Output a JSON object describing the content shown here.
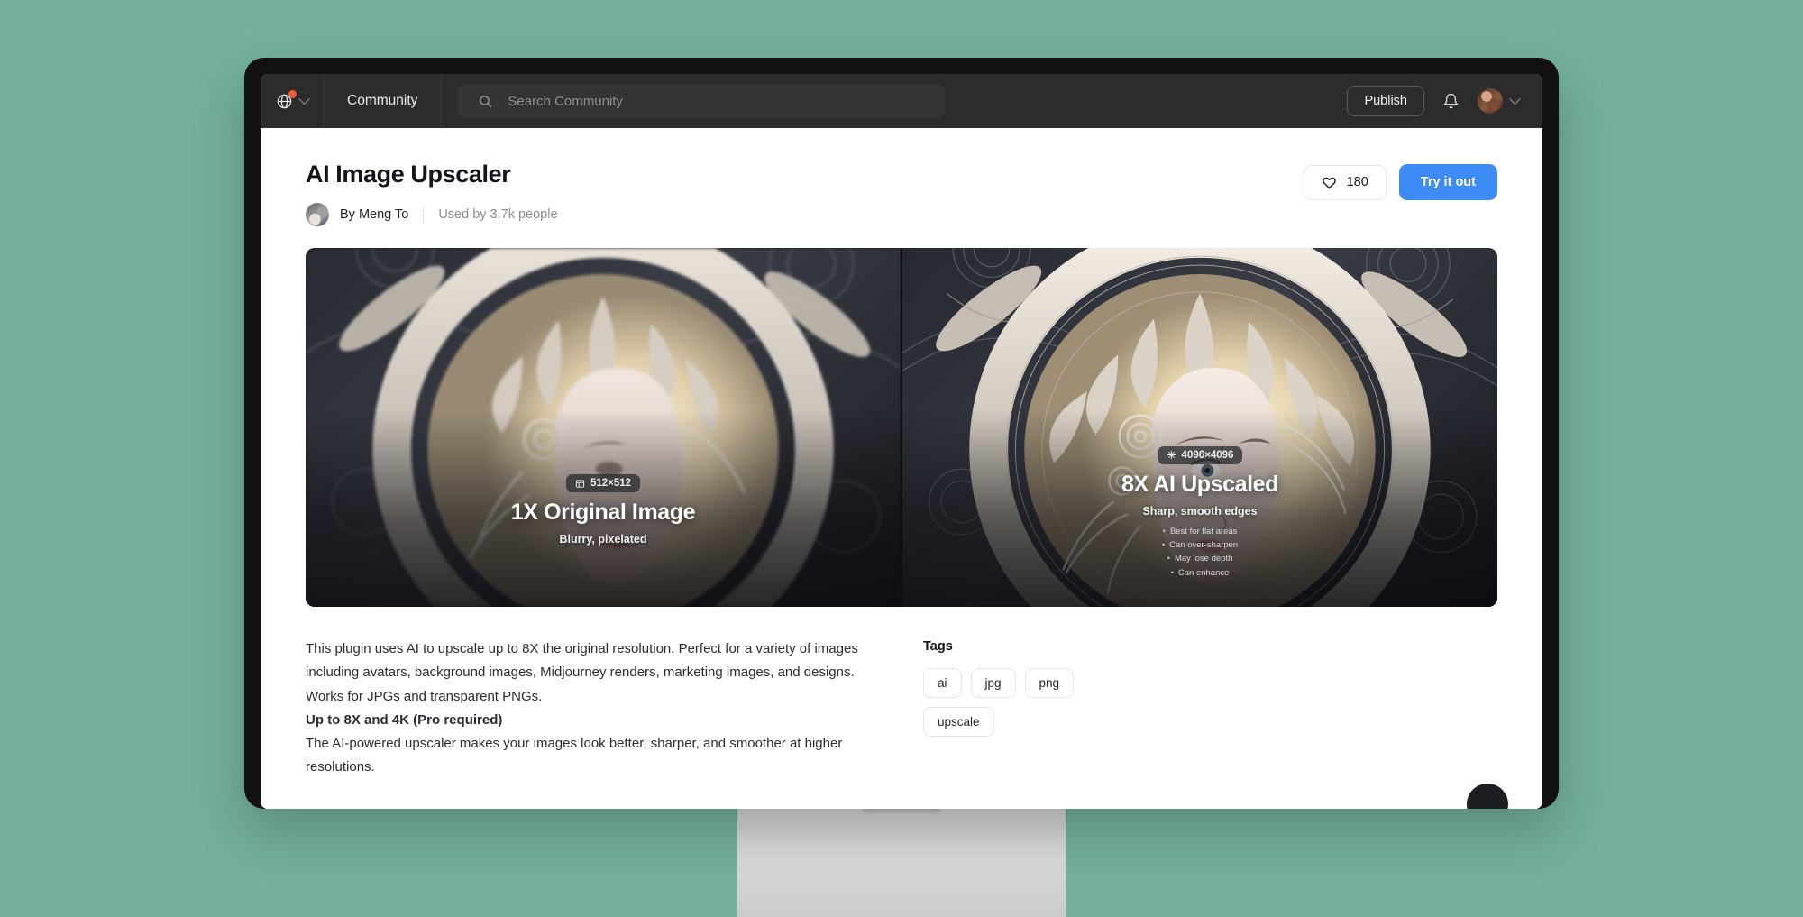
{
  "theme": {
    "desktop_background": "#74b09e",
    "toolbar_background": "#2c2c2e",
    "accent_blue": "#3d8bf5",
    "notification_dot": "#eb5d36"
  },
  "toolbar": {
    "globe_icon": "globe-icon",
    "globe_chevron_icon": "chevron-down-icon",
    "community_label": "Community",
    "search": {
      "icon": "search-icon",
      "placeholder": "Search Community",
      "value": ""
    },
    "publish_label": "Publish",
    "bell_icon": "bell-icon",
    "avatar": "user-avatar",
    "avatar_chevron_icon": "chevron-down-icon"
  },
  "header": {
    "title": "AI Image Upscaler",
    "author_prefix": "By Meng To",
    "usage": "Used by 3.7k people",
    "like": {
      "icon": "heart-icon",
      "count": "180"
    },
    "try_label": "Try it out"
  },
  "hero": {
    "panes": [
      {
        "badge_icon": "frame-icon",
        "badge": "512×512",
        "title": "1X Original Image",
        "subtitle": "Blurry, pixelated",
        "bullets": []
      },
      {
        "badge_icon": "sparkle-icon",
        "badge": "4096×4096",
        "title": "8X AI Upscaled",
        "subtitle": "Sharp, smooth edges",
        "bullets": [
          "Best for flat areas",
          "Can over-sharpen",
          "May lose depth",
          "Can enhance"
        ]
      }
    ]
  },
  "description": {
    "paragraph": "This plugin uses AI to upscale up to 8X the original resolution. Perfect for a variety of images including avatars, background images, Midjourney renders, marketing images, and designs. Works for JPGs and transparent PNGs.",
    "subheading": "Up to 8X and 4K (Pro required)",
    "cut_off_line": "The AI-powered upscaler makes your images look better, sharper, and smoother at higher resolutions."
  },
  "tags": {
    "heading": "Tags",
    "items": [
      "ai",
      "jpg",
      "png",
      "upscale"
    ]
  },
  "fab": {
    "name": "help-button"
  }
}
